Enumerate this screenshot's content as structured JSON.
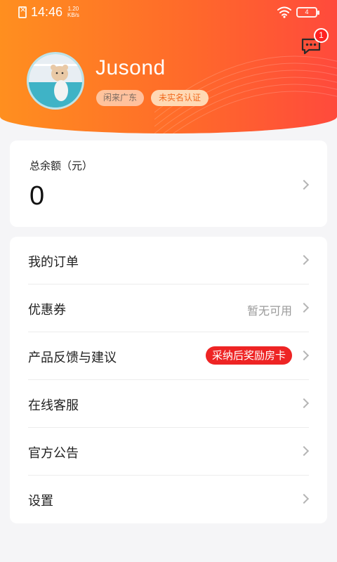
{
  "status_bar": {
    "time": "14:46",
    "net_speed_value": "1.20",
    "net_speed_unit": "KB/s",
    "battery": "4",
    "icons": [
      "sim-icon",
      "wifi-icon",
      "battery-icon"
    ]
  },
  "header": {
    "username": "Jusond",
    "location_tag": "闲来广东",
    "verify_tag": "未实名认证",
    "message_badge": "1",
    "gradient_colors": [
      "#ff8f1f",
      "#ff4a3c"
    ]
  },
  "balance": {
    "label": "总余额（元）",
    "value": "0"
  },
  "menu": {
    "items": [
      {
        "label": "我的订单"
      },
      {
        "label": "优惠券",
        "hint": "暂无可用"
      },
      {
        "label": "产品反馈与建议",
        "promo": "采纳后奖励房卡"
      },
      {
        "label": "在线客服"
      },
      {
        "label": "官方公告"
      },
      {
        "label": "设置"
      }
    ]
  },
  "colors": {
    "accent": "#ff6a2a",
    "promo": "#ee2424",
    "badge": "#ff2222"
  }
}
